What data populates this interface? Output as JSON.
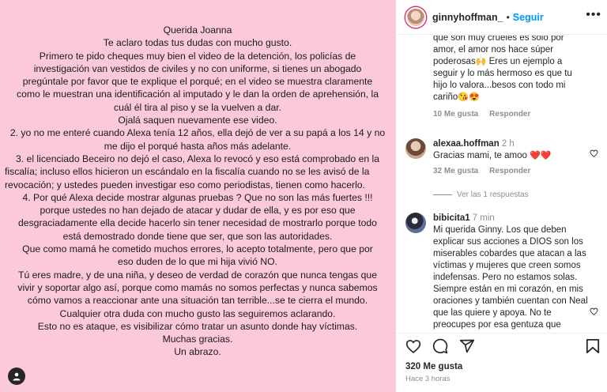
{
  "post": {
    "letter_lines": [
      "Querida Joanna",
      "Te aclaro todas tus dudas con mucho gusto.",
      "Primero te pido cheques muy bien el video de la detención, los policías de",
      "investigación van vestidos de civiles y no con uniforme, si tienes un abogado",
      "pregúntale por favor que te explique el porqué; en el video se muestra claramente",
      "como le muestran una identificación al imputado y le dan la orden de aprehensión, la",
      "cuál él tira al piso y se la vuelven a dar.",
      "Ojalá saquen nuevamente ese video.",
      "2. yo no me enteré cuando Alexa tenía 12 años, ella dejó de ver a su papá a los 14 y no",
      "me dijo el porqué hasta años más adelante.",
      "3. el licenciado Beceiro no dejó el caso, Alexa lo revocó y eso está comprobado en la",
      "fiscalía; incluso ellos hicieron un escándalo en la fiscalía cuando no se les avisó de la",
      "revocación; y ustedes pueden investigar eso como periodistas, tienen como hacerlo.",
      "4. Por qué Alexa decide mostrar algunas pruebas ? Que no son las más fuertes !!!",
      "porque ustedes no han dejado de atacar y dudar de ella, y es por eso que",
      "desgraciadamente ella decide hacerlo sin tener necesidad de mostrarlo porque todo",
      "está demostrado donde  tiene que ser, que son las autoridades.",
      "Que como mamá he cometido muchos errores, lo acepto totalmente, pero que por",
      "eso duden de lo que mi hija vivió NO.",
      "Tú eres madre, y de una niña, y deseo de verdad de corazón que nunca tengas que",
      "vivir y soportar algo así, porque como mamás no somos perfectas y nunca sabemos",
      "cómo vamos a reaccionar ante una situación tan terrible...se te cierra el mundo.",
      "Cualquier otra duda con mucho gusto las seguiremos aclarando.",
      "Esto no es ataque, es visibilizar cómo tratar un asunto donde hay víctimas.",
      "Muchas gracias.",
      "Un abrazo."
    ],
    "background_color": "#fcc9d8"
  },
  "header": {
    "username": "ginnyhoffman_",
    "separator": "•",
    "follow_label": "Seguir",
    "more_label": "•••"
  },
  "comments": {
    "continued": {
      "text": "que son muy crueles es solo por amor, el amor nos hace súper poderosas",
      "emoji1": "🙌",
      "text2": " Eres un ejemplo a seguir y lo más hermoso es que tu hijo lo valora...besos con todo mi cariño",
      "emoji2": "😘😍",
      "likes": "10 Me gusta",
      "reply": "Responder"
    },
    "alexa": {
      "username": "alexaa.hoffman",
      "age": "2 h",
      "text": "Gracias mami, te amoo",
      "emoji": "❤️❤️",
      "likes": "32 Me gusta",
      "reply": "Responder",
      "view_replies": "Ver las 1 respuestas"
    },
    "bibicita": {
      "username": "bibicita1",
      "age": "7 min",
      "text": "Mi querida Ginny. Los que deben explicar sus acciones a DIOS son los miserables cobardes que atacan a las víctimas y mujeres que creen somos indefensas. Pero no estamos solas. Siempre están en mi corazón, en mis oraciones y también cuentan con Neal que las quiere y apoya. No te preocupes por esa gentuza que"
    }
  },
  "footer": {
    "likes": "320 Me gusta",
    "time": "Hace 3 horas"
  },
  "colors": {
    "follow": "#0095f6",
    "heart_red": "#ed4956",
    "text": "#262626",
    "muted": "#8e8e8e"
  }
}
